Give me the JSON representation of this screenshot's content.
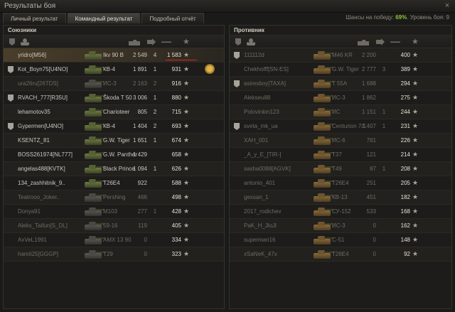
{
  "window": {
    "title": "Результаты боя",
    "close_glyph": "×"
  },
  "tabs": [
    {
      "label": "Личный результат",
      "active": false
    },
    {
      "label": "Командный результат",
      "active": true
    },
    {
      "label": "Подробный отчёт",
      "active": false
    }
  ],
  "win_chance": {
    "prefix": "Шансы на победу: ",
    "value": "69%",
    "level_text": ". Уровень боя: 9"
  },
  "allies": {
    "title": "Союзники",
    "rows": [
      {
        "player": "yridro[M56]",
        "tank": "Ikv 90 B",
        "damage": "2 549",
        "kills": "4",
        "xp": "1 583",
        "rank": false,
        "self": true,
        "dead": false,
        "medal": false,
        "underline": true
      },
      {
        "player": "Kot_Boyn75[U4NO]",
        "tank": "КВ-4",
        "damage": "1 891",
        "kills": "1",
        "xp": "931",
        "rank": true,
        "self": false,
        "dead": false,
        "medal": true
      },
      {
        "player": "ura26ru[26TDS]",
        "tank": "ИС-3",
        "damage": "2 163",
        "kills": "2",
        "xp": "916",
        "rank": false,
        "self": false,
        "dead": true,
        "medal": false
      },
      {
        "player": "RVACH_777[R35U]",
        "tank": "Škoda T 50",
        "damage": "3 006",
        "kills": "1",
        "xp": "880",
        "rank": true,
        "self": false,
        "dead": false,
        "medal": false
      },
      {
        "player": "lehamotov35",
        "tank": "Charioteer",
        "damage": "805",
        "kills": "2",
        "xp": "715",
        "rank": false,
        "self": false,
        "dead": false,
        "medal": false
      },
      {
        "player": "Gypermen[U4NO]",
        "tank": "КВ-4",
        "damage": "1 404",
        "kills": "2",
        "xp": "693",
        "rank": true,
        "self": false,
        "dead": false,
        "medal": false
      },
      {
        "player": "KSENTZ_81",
        "tank": "G.W. Tiger",
        "damage": "1 651",
        "kills": "1",
        "xp": "674",
        "rank": false,
        "self": false,
        "dead": false,
        "medal": false
      },
      {
        "player": "BOSS261974[NL777]",
        "tank": "G.W. Panther",
        "damage": "1 429",
        "kills": "",
        "xp": "658",
        "rank": false,
        "self": false,
        "dead": false,
        "medal": false
      },
      {
        "player": "angelas488[KVTK]",
        "tank": "Black Prince",
        "damage": "1 094",
        "kills": "1",
        "xp": "626",
        "rank": false,
        "self": false,
        "dead": false,
        "medal": false
      },
      {
        "player": "134_zashhitnik_9..",
        "tank": "T26E4",
        "damage": "922",
        "kills": "",
        "xp": "588",
        "rank": false,
        "self": false,
        "dead": false,
        "medal": false
      },
      {
        "player": "Teatrooo_Joker..",
        "tank": "Pershing",
        "damage": "466",
        "kills": "",
        "xp": "498",
        "rank": false,
        "self": false,
        "dead": true,
        "medal": false
      },
      {
        "player": "Donya91",
        "tank": "M103",
        "damage": "277",
        "kills": "1",
        "xp": "428",
        "rank": false,
        "self": false,
        "dead": true,
        "medal": false
      },
      {
        "player": "Aleks_Taifun[S_DL]",
        "tank": "59-16",
        "damage": "119",
        "kills": "",
        "xp": "405",
        "rank": false,
        "self": false,
        "dead": true,
        "medal": false
      },
      {
        "player": "AxVeL1991",
        "tank": "AMX 13 90",
        "damage": "0",
        "kills": "",
        "xp": "334",
        "rank": false,
        "self": false,
        "dead": true,
        "medal": false
      },
      {
        "player": "hamit25[GGGP]",
        "tank": "T29",
        "damage": "0",
        "kills": "",
        "xp": "323",
        "rank": false,
        "self": false,
        "dead": true,
        "medal": false
      }
    ]
  },
  "enemies": {
    "title": "Противник",
    "rows": [
      {
        "player": "111112d",
        "tank": "M46 KR",
        "damage": "2 200",
        "kills": "",
        "xp": "400",
        "rank": true,
        "dead": true
      },
      {
        "player": "Chekhofff[SN-ES]",
        "tank": "G.W. Tiger",
        "damage": "2 777",
        "kills": "3",
        "xp": "389",
        "rank": false,
        "dead": true
      },
      {
        "player": "asiresboy[TAXA]",
        "tank": "T 55A",
        "damage": "1 688",
        "kills": "",
        "xp": "294",
        "rank": true,
        "dead": true
      },
      {
        "player": "Alekseu88",
        "tank": "ИС-3",
        "damage": "1 862",
        "kills": "",
        "xp": "275",
        "rank": false,
        "dead": true
      },
      {
        "player": "Polovinkin123",
        "tank": "ИС",
        "damage": "1 151",
        "kills": "1",
        "xp": "244",
        "rank": false,
        "dead": true
      },
      {
        "player": "sveta_mk_ua",
        "tank": "Centurion 7/1",
        "damage": "1 407",
        "kills": "1",
        "xp": "231",
        "rank": true,
        "dead": true
      },
      {
        "player": "ХАН_001",
        "tank": "ИС-6",
        "damage": "761",
        "kills": "",
        "xp": "226",
        "rank": false,
        "dead": true
      },
      {
        "player": "_А_у_Е_[TIR-]",
        "tank": "T37",
        "damage": "121",
        "kills": "",
        "xp": "214",
        "rank": false,
        "dead": true
      },
      {
        "player": "sasha0088[AGVK]",
        "tank": "T49",
        "damage": "87",
        "kills": "1",
        "xp": "208",
        "rank": false,
        "dead": true
      },
      {
        "player": "antonio_401",
        "tank": "T26E4",
        "damage": "251",
        "kills": "",
        "xp": "205",
        "rank": false,
        "dead": true
      },
      {
        "player": "gexsan_1",
        "tank": "КВ-13",
        "damage": "451",
        "kills": "",
        "xp": "182",
        "rank": false,
        "dead": true
      },
      {
        "player": "2017_rodichev",
        "tank": "СУ-152",
        "damage": "533",
        "kills": "",
        "xp": "168",
        "rank": false,
        "dead": true
      },
      {
        "player": "PaK_H_JloJl",
        "tank": "ИС-3",
        "damage": "0",
        "kills": "",
        "xp": "162",
        "rank": false,
        "dead": true
      },
      {
        "player": "superman16",
        "tank": "С-51",
        "damage": "0",
        "kills": "",
        "xp": "148",
        "rank": false,
        "dead": true
      },
      {
        "player": "xSaNeK_47x",
        "tank": "T26E4",
        "damage": "0",
        "kills": "",
        "xp": "92",
        "rank": false,
        "dead": true
      }
    ]
  },
  "icons": {
    "star": "★",
    "column_icons": [
      "clan-tag-icon",
      "player-icon",
      "vehicle-icon",
      "frags-icon",
      "damage-icon",
      "xp-star-icon"
    ]
  },
  "colors": {
    "win_chance": "#8ec63f",
    "self_row": "#4a3e2a",
    "underline": "#dd2222"
  }
}
